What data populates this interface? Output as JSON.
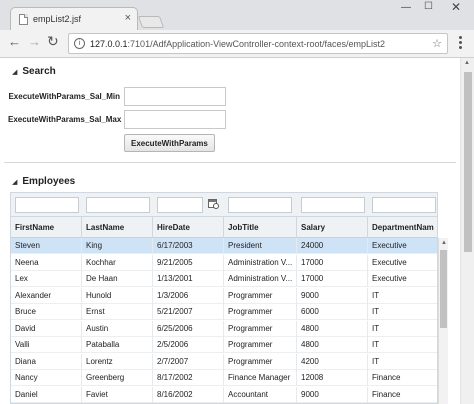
{
  "browser": {
    "tab_title": "empList2.jsf",
    "tab_close": "×",
    "url_host": "127.0.0.1",
    "url_rest": ":7101/AdfApplication-ViewController-context-root/faces/empList2",
    "icons": {
      "back": "arrow-left-icon",
      "forward": "arrow-right-icon",
      "reload": "reload-icon",
      "info": "info-icon",
      "bookmark": "star-icon",
      "menu": "three-dots-icon"
    }
  },
  "search": {
    "title": "Search",
    "sal_min_label": "ExecuteWithParams_Sal_Min",
    "sal_min_value": "",
    "sal_max_label": "ExecuteWithParams_Sal_Max",
    "sal_max_value": "",
    "button_label": "ExecuteWithParams"
  },
  "employees": {
    "title": "Employees",
    "columns": [
      "FirstName",
      "LastName",
      "HireDate",
      "JobTitle",
      "Salary",
      "DepartmentNam"
    ],
    "rows": [
      [
        "Steven",
        "King",
        "6/17/2003",
        "President",
        "24000",
        "Executive"
      ],
      [
        "Neena",
        "Kochhar",
        "9/21/2005",
        "Administration V...",
        "17000",
        "Executive"
      ],
      [
        "Lex",
        "De Haan",
        "1/13/2001",
        "Administration V...",
        "17000",
        "Executive"
      ],
      [
        "Alexander",
        "Hunold",
        "1/3/2006",
        "Programmer",
        "9000",
        "IT"
      ],
      [
        "Bruce",
        "Ernst",
        "5/21/2007",
        "Programmer",
        "6000",
        "IT"
      ],
      [
        "David",
        "Austin",
        "6/25/2006",
        "Programmer",
        "4800",
        "IT"
      ],
      [
        "Valli",
        "Pataballa",
        "2/5/2006",
        "Programmer",
        "4800",
        "IT"
      ],
      [
        "Diana",
        "Lorentz",
        "2/7/2007",
        "Programmer",
        "4200",
        "IT"
      ],
      [
        "Nancy",
        "Greenberg",
        "8/17/2002",
        "Finance Manager",
        "12008",
        "Finance"
      ],
      [
        "Daniel",
        "Faviet",
        "8/16/2002",
        "Accountant",
        "9000",
        "Finance"
      ]
    ],
    "selected_row": 0,
    "hire_date_filter_icon": "calendar-clock-icon"
  },
  "colors": {
    "selected_row": "#cfe3f7",
    "header_bg": "#eef2f5"
  }
}
